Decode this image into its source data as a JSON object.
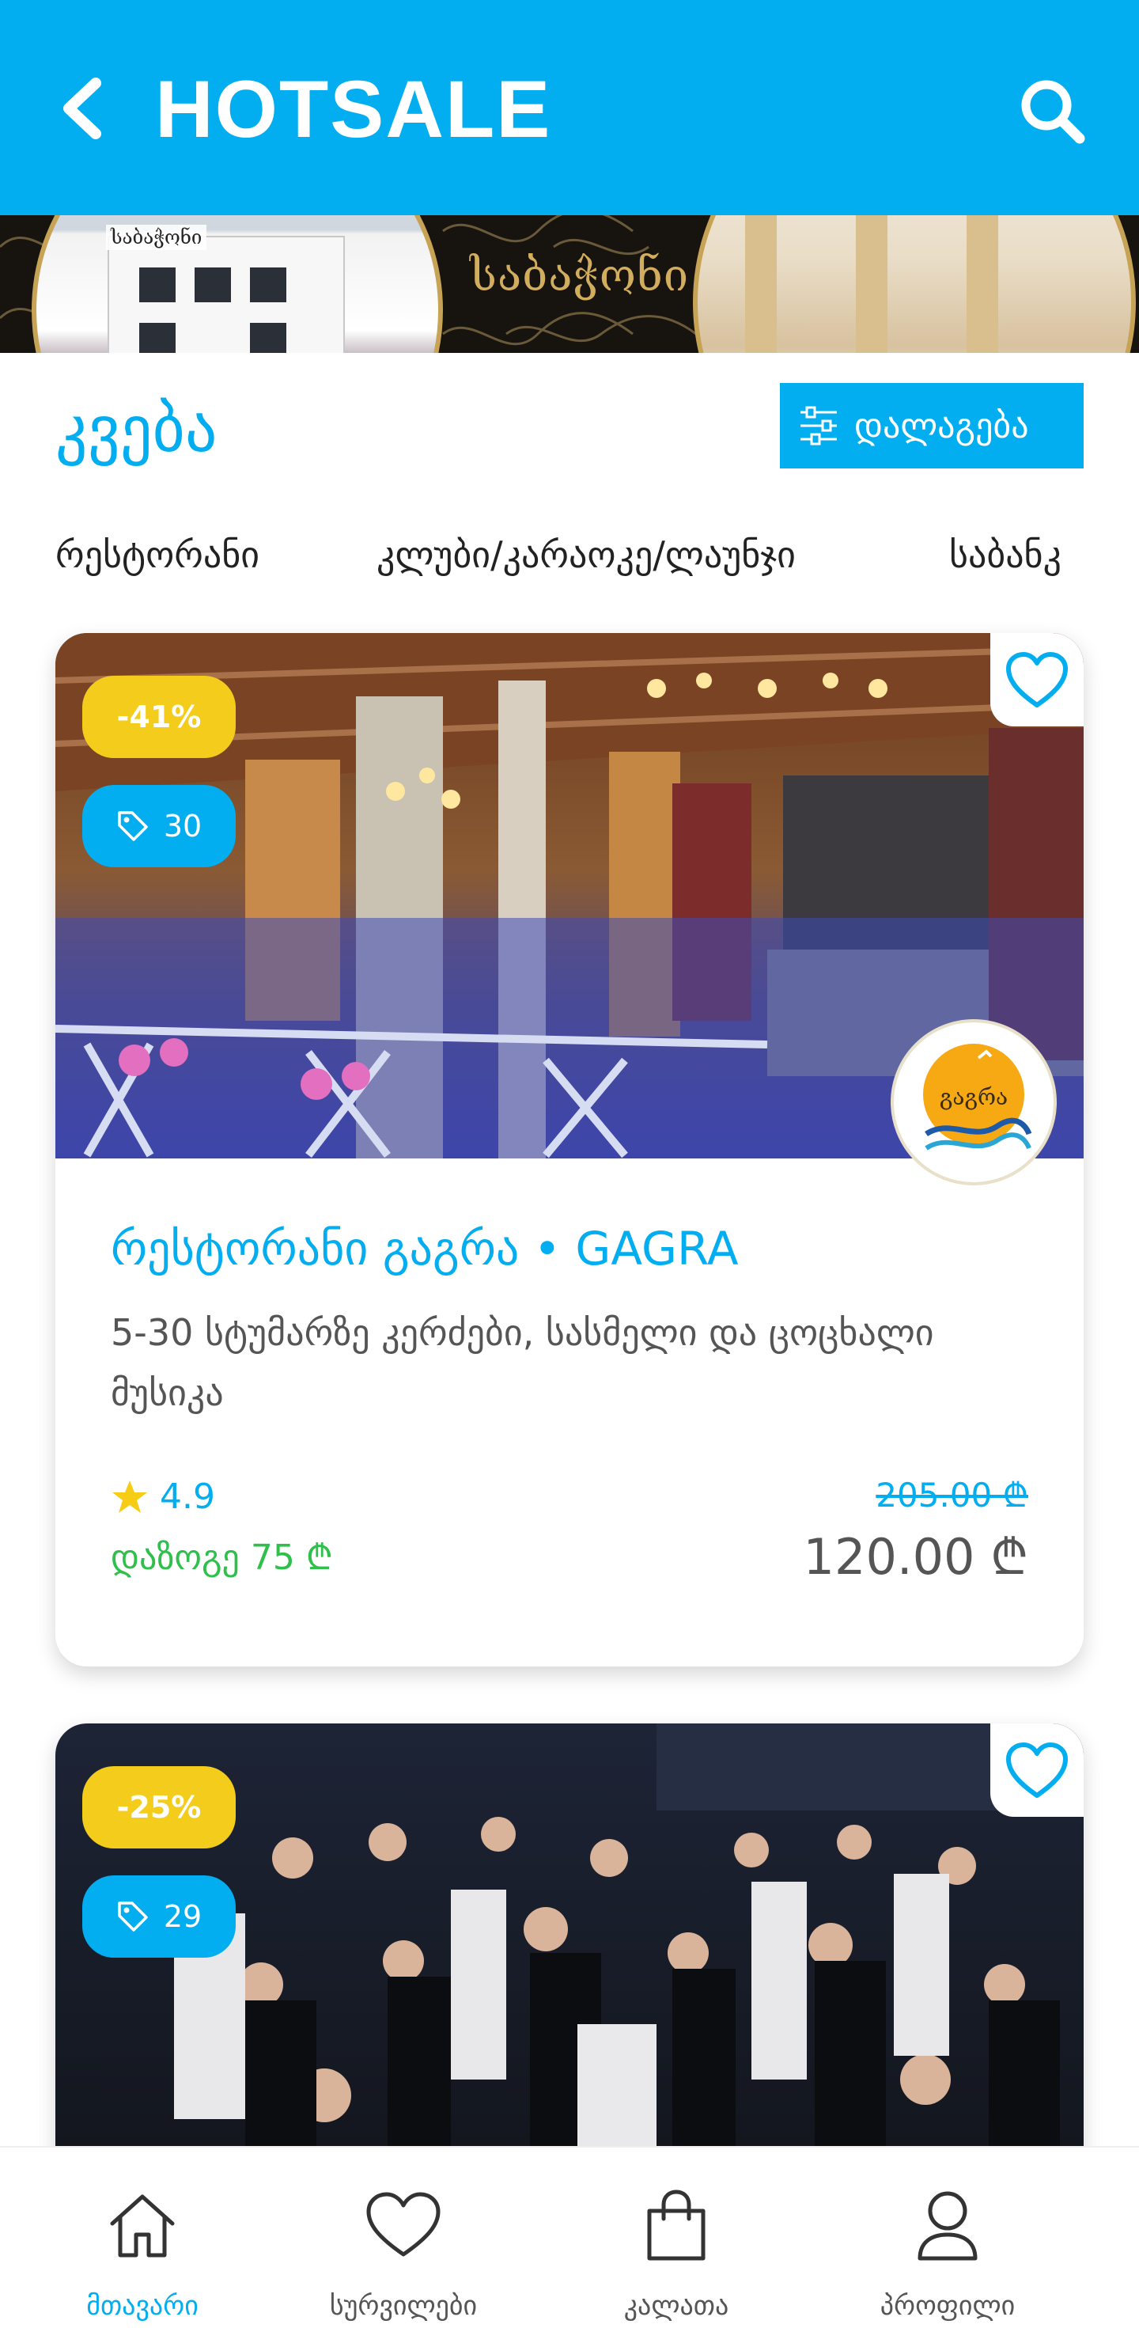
{
  "header": {
    "title": "HOTSALE",
    "back_icon": "chevron-left-icon",
    "search_icon": "search-icon",
    "background_color": "#02aef0"
  },
  "banner": {
    "logo_text": "საბაჭონი",
    "small_logo_text": "საბაჭონი"
  },
  "section": {
    "title": "კვება",
    "sort_label": "დალაგება",
    "sort_icon": "sliders-icon"
  },
  "tabs": [
    {
      "label": "რესტორანი"
    },
    {
      "label": "კლუბი/კარაოკე/ლაუნჯი"
    },
    {
      "label": "საბანკ"
    }
  ],
  "cards": [
    {
      "discount": "-41%",
      "count": "30",
      "logo_text": "გაგრა",
      "title": "რესტორანი გაგრა • GAGRA",
      "description": "5-30 სტუმარზე კერძები, სასმელი და ცოცხალი მუსიკა",
      "rating": "4.9",
      "savings": "დაზოგე 75 ₾",
      "old_price": "205.00 ₾",
      "new_price": "120.00 ₾"
    },
    {
      "discount": "-25%",
      "count": "29"
    }
  ],
  "bottom_nav": [
    {
      "label": "მთავარი",
      "icon": "home-icon",
      "active": true
    },
    {
      "label": "სურვილები",
      "icon": "heart-icon",
      "active": false
    },
    {
      "label": "კალათა",
      "icon": "shopping-bag-icon",
      "active": false
    },
    {
      "label": "პროფილი",
      "icon": "user-icon",
      "active": false
    }
  ],
  "colors": {
    "accent": "#02aef0",
    "discount_badge": "#f4cd1c",
    "savings": "#2fbf4b",
    "star": "#f6cc14"
  }
}
